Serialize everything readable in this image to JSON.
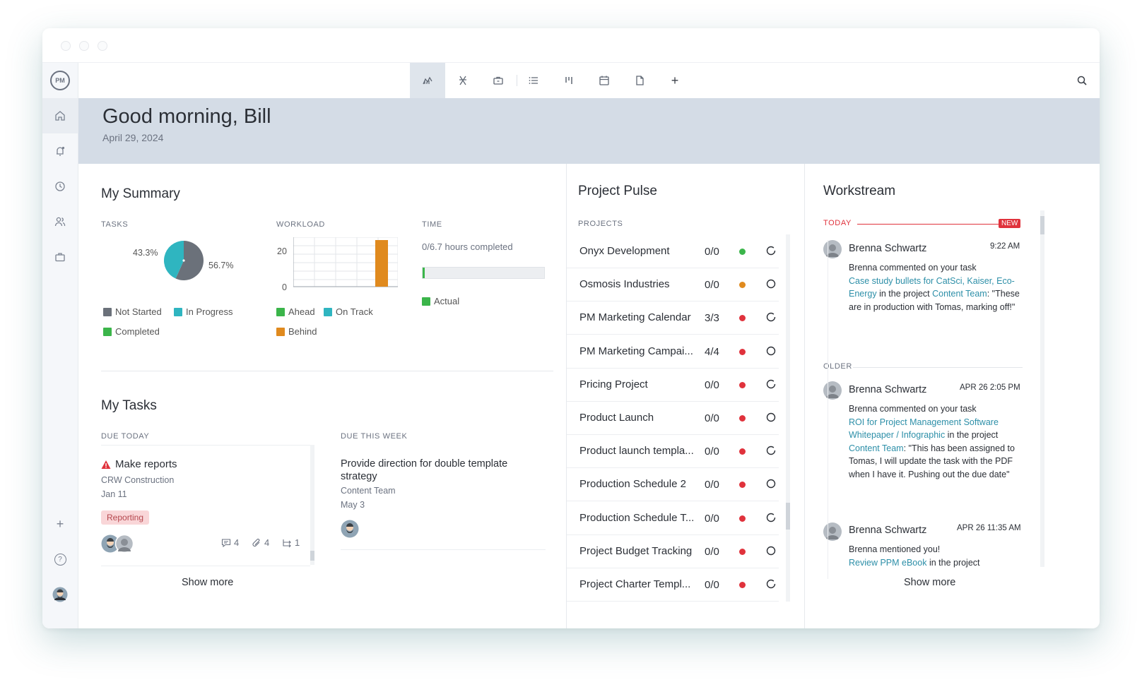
{
  "app": {
    "logo_text": "PM"
  },
  "header": {
    "greeting": "Good morning, Bill",
    "date": "April 29, 2024"
  },
  "toolbar": {
    "items": [
      {
        "name": "overview",
        "icon": "dashboard-icon"
      },
      {
        "name": "portfolio",
        "icon": "roadmap-icon"
      },
      {
        "name": "projects",
        "icon": "briefcase-icon"
      },
      {
        "name": "list",
        "icon": "list-icon"
      },
      {
        "name": "board",
        "icon": "board-icon"
      },
      {
        "name": "calendar",
        "icon": "calendar-icon"
      },
      {
        "name": "docs",
        "icon": "document-icon"
      },
      {
        "name": "add",
        "icon": "plus-icon"
      }
    ],
    "plus": "+"
  },
  "sidebar": {
    "items": [
      "home-icon",
      "notifications-icon",
      "clock-icon",
      "team-icon",
      "briefcase-icon"
    ],
    "add": "+",
    "help": "?"
  },
  "summary": {
    "title": "My Summary",
    "tasks": {
      "label": "TASKS",
      "pie": [
        {
          "name": "Not Started",
          "value": 56.7,
          "color": "#6b717a"
        },
        {
          "name": "In Progress",
          "value": 43.3,
          "color": "#2fb5c0"
        }
      ],
      "left_pct": "43.3%",
      "right_pct": "56.7%",
      "legend": [
        "Not Started",
        "In Progress",
        "Completed"
      ]
    },
    "workload": {
      "label": "WORKLOAD",
      "y_top": "20",
      "y_bottom": "0",
      "legend": [
        "Ahead",
        "On Track",
        "Behind"
      ]
    },
    "time": {
      "label": "TIME",
      "hours": "0/6.7 hours completed",
      "progress": 0.02,
      "legend": "Actual"
    }
  },
  "tasks": {
    "title": "My Tasks",
    "due_today": {
      "label": "DUE TODAY",
      "task": {
        "name": "Make reports",
        "project": "CRW Construction",
        "date": "Jan 11",
        "tag": "Reporting",
        "comments": "4",
        "attachments": "4",
        "subtasks": "1"
      }
    },
    "due_week": {
      "label": "DUE THIS WEEK",
      "task": {
        "name": "Provide direction for double template strategy",
        "project": "Content Team",
        "date": "May 3"
      }
    },
    "show_more": "Show more"
  },
  "pulse": {
    "title": "Project Pulse",
    "col_label": "PROJECTS",
    "rows": [
      {
        "name": "Onyx Development",
        "count": "0/0",
        "status": "green"
      },
      {
        "name": "Osmosis Industries",
        "count": "0/0",
        "status": "orange"
      },
      {
        "name": "PM Marketing Calendar",
        "count": "3/3",
        "status": "red"
      },
      {
        "name": "PM Marketing Campai...",
        "count": "4/4",
        "status": "red"
      },
      {
        "name": "Pricing Project",
        "count": "0/0",
        "status": "red"
      },
      {
        "name": "Product Launch",
        "count": "0/0",
        "status": "red"
      },
      {
        "name": "Product launch templa...",
        "count": "0/0",
        "status": "red"
      },
      {
        "name": "Production Schedule 2",
        "count": "0/0",
        "status": "red"
      },
      {
        "name": "Production Schedule T...",
        "count": "0/0",
        "status": "red"
      },
      {
        "name": "Project Budget Tracking",
        "count": "0/0",
        "status": "red"
      },
      {
        "name": "Project Charter Templ...",
        "count": "0/0",
        "status": "red"
      }
    ]
  },
  "workstream": {
    "title": "Workstream",
    "today_label": "TODAY",
    "new_badge": "NEW",
    "older_label": "OLDER",
    "show_more": "Show more",
    "entries": [
      {
        "author": "Brenna Schwartz",
        "time": "9:22 AM",
        "intro": "Brenna commented on your task",
        "link1": "Case study bullets for CatSci, Kaiser, Eco-Energy",
        "mid": " in the project ",
        "link2": "Content Team",
        "tail": ": \"These are in production with Tomas, marking off!\""
      },
      {
        "author": "Brenna Schwartz",
        "time": "APR 26 2:05 PM",
        "intro": "Brenna commented on your task",
        "link1": "ROI for Project Management Software Whitepaper / Infographic",
        "mid": " in the project ",
        "link2": "Content Team",
        "tail": ": \"This has been assigned to Tomas, I will update the task with the PDF when I have it. Pushing out the due date\""
      },
      {
        "author": "Brenna Schwartz",
        "time": "APR 26 11:35 AM",
        "intro": "Brenna mentioned you!",
        "link1": "Review PPM eBook",
        "mid": " in the project",
        "link2": "",
        "tail": ""
      }
    ]
  },
  "colors": {
    "green": "#3bb54a",
    "orange": "#e08a1e",
    "red": "#e0323c",
    "teal": "#2fb5c0",
    "grey": "#6b717a"
  }
}
